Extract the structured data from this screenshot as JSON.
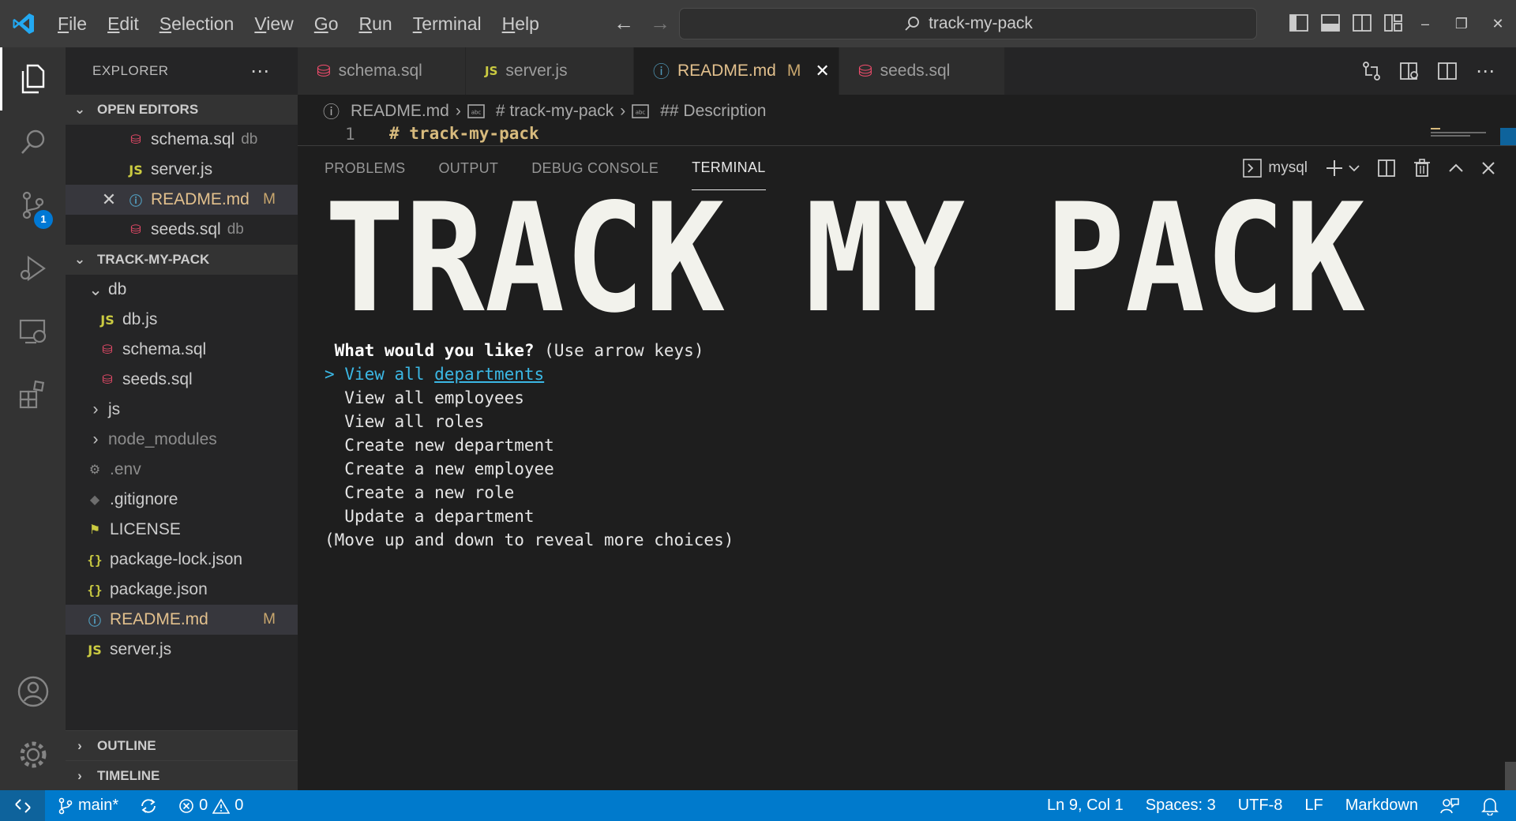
{
  "titlebar": {
    "menu": [
      "File",
      "Edit",
      "Selection",
      "View",
      "Go",
      "Run",
      "Terminal",
      "Help"
    ],
    "command_center": "track-my-pack"
  },
  "activitybar": {
    "items": [
      "explorer-icon",
      "search-icon",
      "source-control-icon",
      "run-debug-icon",
      "remote-explorer-icon",
      "extensions-icon",
      "account-icon",
      "manage-gear-icon"
    ],
    "scm_badge": "1"
  },
  "sidebar": {
    "title": "EXPLORER",
    "open_editors": {
      "title": "OPEN EDITORS",
      "items": [
        {
          "name": "schema.sql",
          "desc": "db"
        },
        {
          "name": "server.js",
          "desc": ""
        },
        {
          "name": "README.md",
          "desc": "M"
        },
        {
          "name": "seeds.sql",
          "desc": "db"
        }
      ]
    },
    "project": {
      "title": "TRACK-MY-PACK",
      "items": [
        {
          "name": "db"
        },
        {
          "name": "db.js"
        },
        {
          "name": "schema.sql"
        },
        {
          "name": "seeds.sql"
        },
        {
          "name": "js"
        },
        {
          "name": "node_modules"
        },
        {
          "name": ".env"
        },
        {
          "name": ".gitignore"
        },
        {
          "name": "LICENSE"
        },
        {
          "name": "package-lock.json"
        },
        {
          "name": "package.json"
        },
        {
          "name": "README.md",
          "status": "M"
        },
        {
          "name": "server.js"
        }
      ]
    },
    "outline": "OUTLINE",
    "timeline": "TIMELINE"
  },
  "tabs": [
    {
      "label": "schema.sql"
    },
    {
      "label": "server.js"
    },
    {
      "label": "README.md",
      "status": "M"
    },
    {
      "label": "seeds.sql"
    }
  ],
  "breadcrumb": [
    "README.md",
    "# track-my-pack",
    "## Description"
  ],
  "editor": {
    "line_number": "1",
    "line_text": "# track-my-pack"
  },
  "panel": {
    "tabs": [
      "PROBLEMS",
      "OUTPUT",
      "DEBUG CONSOLE",
      "TERMINAL"
    ],
    "terminal_name": "mysql"
  },
  "terminal": {
    "banner_text": "TRACK MY PACK",
    "question": "What would you like?",
    "hint": " (Use arrow keys)",
    "pointer": ">",
    "selected_prefix": "View all ",
    "selected_highlight": "departments",
    "choices": [
      "View all employees",
      "View all roles",
      "Create new department",
      "Create a new employee",
      "Create a new role",
      "Update a department"
    ],
    "footer": "(Move up and down to reveal more choices)"
  },
  "statusbar": {
    "branch": "main*",
    "errors": "0",
    "warnings": "0",
    "position": "Ln 9, Col 1",
    "spaces": "Spaces: 3",
    "encoding": "UTF-8",
    "eol": "LF",
    "language": "Markdown"
  },
  "colors": {
    "accent": "#007acc",
    "modified": "#e2c08d",
    "sql_icon": "#f14c6c",
    "js_icon": "#cbcb41",
    "info_icon": "#519aba",
    "terminal_selected": "#3bb8e5"
  }
}
